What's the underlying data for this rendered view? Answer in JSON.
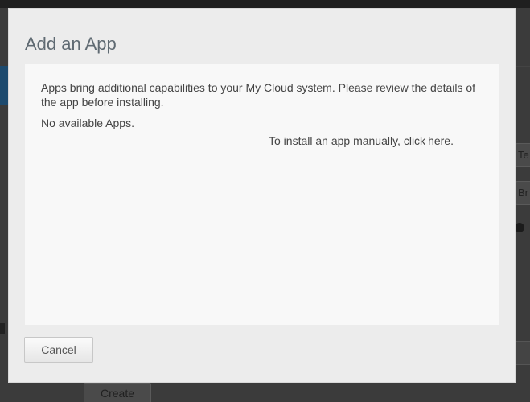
{
  "background": {
    "field_1_text": "Te",
    "field_2_text": "Br",
    "create_button_label": "Create"
  },
  "dialog": {
    "title": "Add an App",
    "description": "Apps bring additional capabilities to your My Cloud system. Please review the details of the app before installing.",
    "empty_message": "No available Apps.",
    "manual_install_text": "To install an app manually, click",
    "manual_install_link": "here.",
    "cancel_label": "Cancel"
  }
}
